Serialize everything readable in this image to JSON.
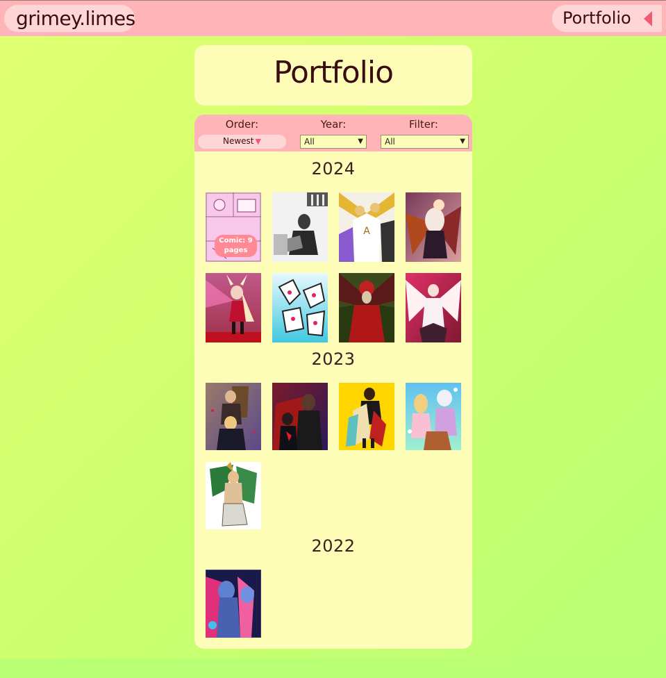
{
  "header": {
    "brand": "grimey.limes",
    "nav_label": "Portfolio"
  },
  "page": {
    "title": "Portfolio"
  },
  "controls": {
    "order_label": "Order:",
    "order_value": "Newest",
    "year_label": "Year:",
    "year_value": "All",
    "filter_label": "Filter:",
    "filter_value": "All"
  },
  "sections": [
    {
      "year": "2024",
      "badge": "Comic: 9 pages"
    },
    {
      "year": "2023"
    },
    {
      "year": "2022"
    }
  ],
  "colors": {
    "topbar": "#ffb4b8",
    "pill": "#ffd6d6",
    "card": "#fdfdb8",
    "accent": "#f05a72"
  }
}
